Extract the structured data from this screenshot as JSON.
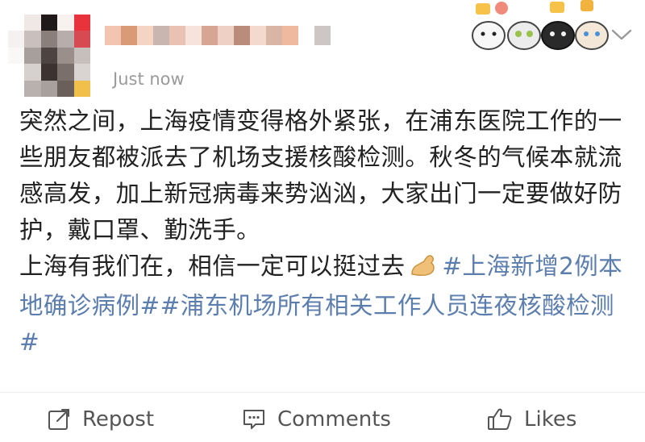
{
  "post": {
    "timestamp": "Just now",
    "body_paragraph_1": "突然之间，上海疫情变得格外紧张，在浦东医院工作的一些朋友都被派去了机场支援核酸检测。秋冬的气候本就流感高发，加上新冠病毒来势汹汹，大家出门一定要做好防护，戴口罩、勤洗手。",
    "body_paragraph_2_text": "上海有我们在，相信一定可以挺过去",
    "hashtag_1": "#上海新增2例本地确诊病例#",
    "hashtag_2": "#浦东机场所有相关工作人员连夜核酸检测#",
    "emoji": "flexed-biceps-icon"
  },
  "actions": {
    "repost": "Repost",
    "comments": "Comments",
    "likes": "Likes"
  },
  "icons": {
    "menu": "chevron-down-icon",
    "repost": "repost-icon",
    "comments": "comment-icon",
    "likes": "thumbs-up-icon"
  },
  "colors": {
    "hashtag": "#5c7eae",
    "text": "#222222",
    "secondary": "#9a9a9a"
  }
}
